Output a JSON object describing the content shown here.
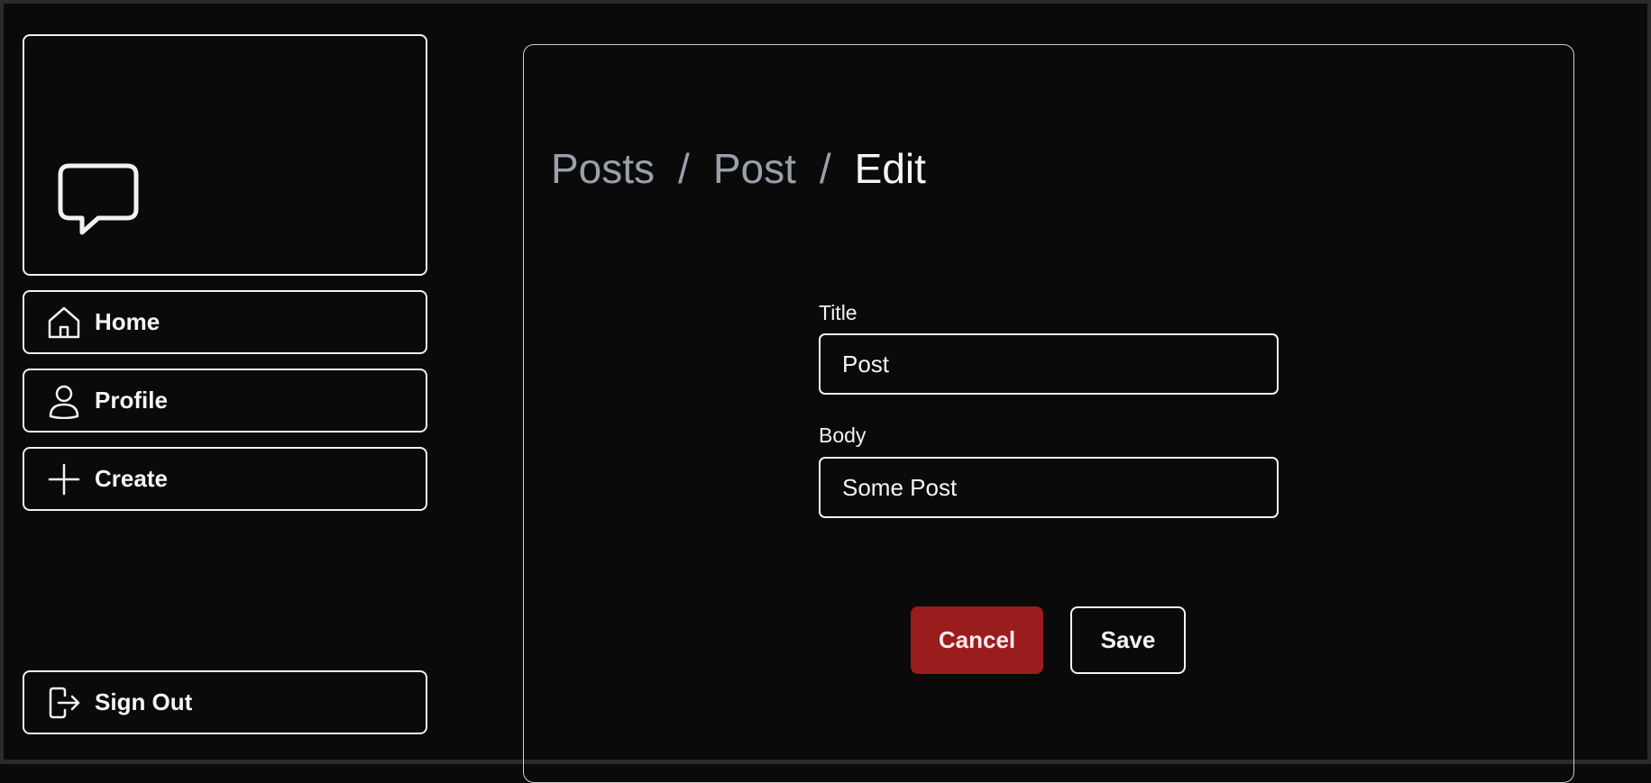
{
  "sidebar": {
    "logo_icon": "speech-bubble-icon",
    "nav": {
      "home": {
        "label": "Home",
        "icon": "home-icon"
      },
      "profile": {
        "label": "Profile",
        "icon": "user-icon"
      },
      "create": {
        "label": "Create",
        "icon": "plus-icon"
      }
    },
    "sign_out": {
      "label": "Sign Out",
      "icon": "sign-out-icon"
    }
  },
  "breadcrumb": {
    "items": [
      "Posts",
      "Post",
      "Edit"
    ],
    "separator": "/"
  },
  "form": {
    "title_label": "Title",
    "title_value": "Post",
    "body_label": "Body",
    "body_value": "Some Post",
    "cancel_label": "Cancel",
    "save_label": "Save"
  },
  "colors": {
    "background": "#0a0a0a",
    "foreground": "#f2f2f2",
    "muted": "#9aa0ab",
    "danger": "#9b1c1c"
  }
}
